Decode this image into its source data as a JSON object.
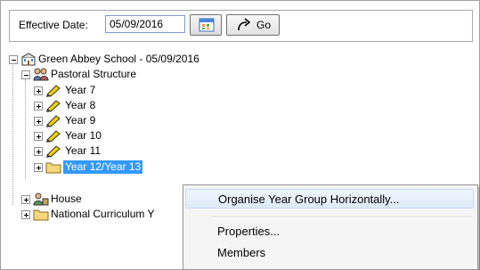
{
  "toolbar": {
    "effective_date_label": "Effective Date:",
    "effective_date_value": "05/09/2016",
    "go_label": "Go"
  },
  "tree": {
    "root": "Green Abbey School - 05/09/2016",
    "pastoral": "Pastoral Structure",
    "years": [
      "Year  7",
      "Year  8",
      "Year  9",
      "Year 10",
      "Year 11"
    ],
    "selected_folder": "Year 12/Year 13",
    "house": "House",
    "national": "National Curriculum Y"
  },
  "context_menu": {
    "items": [
      "Organise Year Group Horizontally...",
      "Properties...",
      "Members"
    ],
    "highlighted_index": 0
  },
  "colors": {
    "selection": "#3399ff",
    "pencil": "#f0d000",
    "folder": "#f6d67a"
  }
}
